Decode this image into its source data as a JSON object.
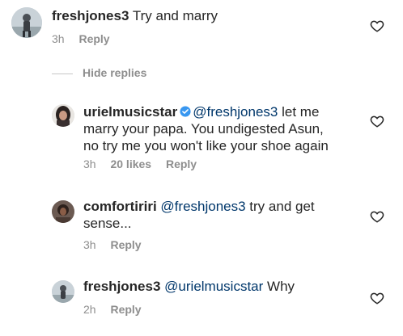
{
  "colors": {
    "text": "#262626",
    "meta": "#8e8e8e",
    "mention": "#00376b",
    "verified": "#3897f0"
  },
  "comments": [
    {
      "username": "freshjones3",
      "text": "Try and marry",
      "time": "3h",
      "reply": "Reply"
    }
  ],
  "hide_replies": "Hide replies",
  "replies": [
    {
      "username": "urielmusicstar",
      "verified": true,
      "mention": "@freshjones3",
      "text_line1": " let me",
      "text_line2": "marry your papa.  You undigested Asun,",
      "text_line3": "no try me you won't like your shoe again",
      "time": "3h",
      "likes": "20 likes",
      "reply": "Reply"
    },
    {
      "username": "comfortiriri",
      "mention": "@freshjones3",
      "text_line1": " try and get",
      "text_line2": "sense...",
      "time": "3h",
      "reply": "Reply"
    },
    {
      "username": "freshjones3",
      "mention": "@urielmusicstar",
      "text_line1": " Why",
      "time": "2h",
      "reply": "Reply"
    }
  ],
  "icons": {
    "like": "heart-icon",
    "verified": "verified-badge-icon"
  }
}
